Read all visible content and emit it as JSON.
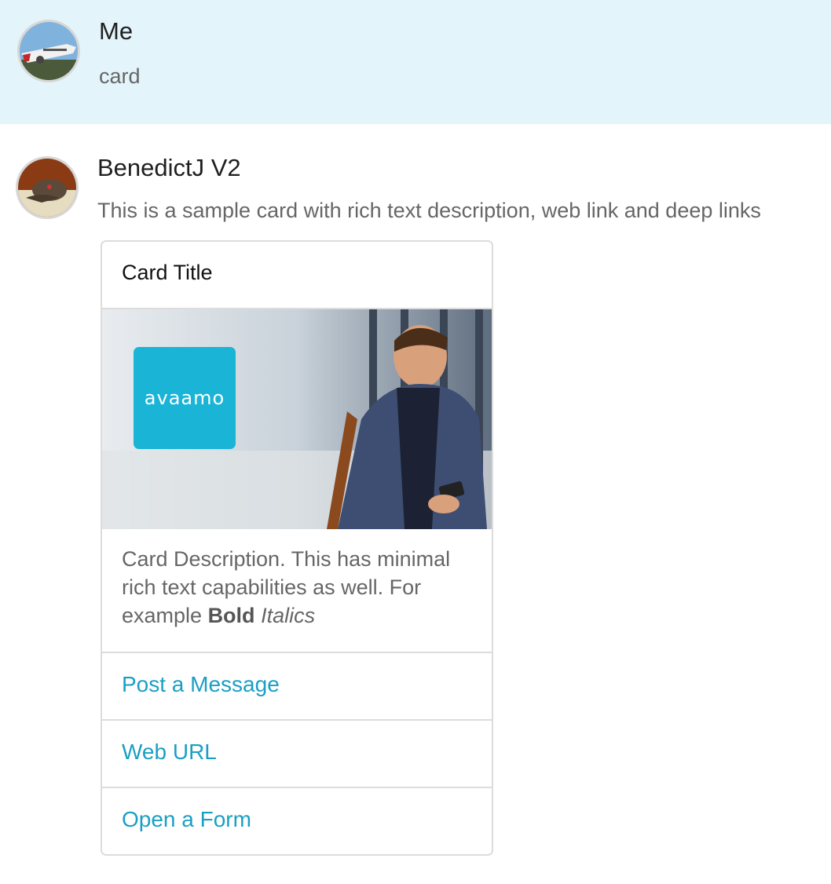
{
  "messages": {
    "me": {
      "sender": "Me",
      "text": "card"
    },
    "bot": {
      "sender": "BenedictJ V2",
      "text": "This is a sample card with rich text description, web link and deep links",
      "card": {
        "title": "Card Title",
        "image": {
          "logo_text": "avaamo",
          "logo_color": "#1ab4d6"
        },
        "description": {
          "plain": "Card Description. This has minimal rich text capabilities as well. For example ",
          "bold": "Bold",
          "italic": "Italics"
        },
        "actions": [
          {
            "label": "Post a Message"
          },
          {
            "label": "Web URL"
          },
          {
            "label": "Open a Form"
          }
        ],
        "link_color": "#1a9fc4"
      }
    }
  }
}
